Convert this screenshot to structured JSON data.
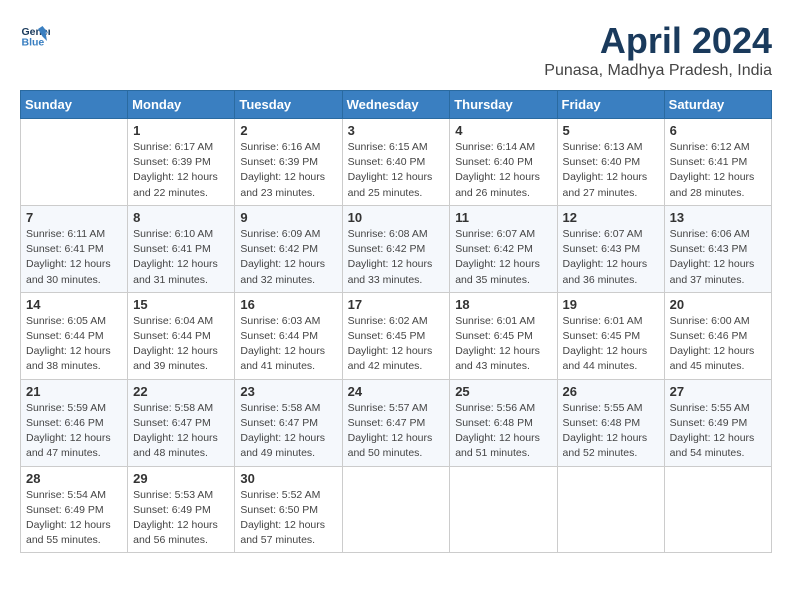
{
  "header": {
    "logo_line1": "General",
    "logo_line2": "Blue",
    "month": "April 2024",
    "location": "Punasa, Madhya Pradesh, India"
  },
  "weekdays": [
    "Sunday",
    "Monday",
    "Tuesday",
    "Wednesday",
    "Thursday",
    "Friday",
    "Saturday"
  ],
  "weeks": [
    [
      {
        "day": "",
        "sunrise": "",
        "sunset": "",
        "daylight": ""
      },
      {
        "day": "1",
        "sunrise": "Sunrise: 6:17 AM",
        "sunset": "Sunset: 6:39 PM",
        "daylight": "Daylight: 12 hours and 22 minutes."
      },
      {
        "day": "2",
        "sunrise": "Sunrise: 6:16 AM",
        "sunset": "Sunset: 6:39 PM",
        "daylight": "Daylight: 12 hours and 23 minutes."
      },
      {
        "day": "3",
        "sunrise": "Sunrise: 6:15 AM",
        "sunset": "Sunset: 6:40 PM",
        "daylight": "Daylight: 12 hours and 25 minutes."
      },
      {
        "day": "4",
        "sunrise": "Sunrise: 6:14 AM",
        "sunset": "Sunset: 6:40 PM",
        "daylight": "Daylight: 12 hours and 26 minutes."
      },
      {
        "day": "5",
        "sunrise": "Sunrise: 6:13 AM",
        "sunset": "Sunset: 6:40 PM",
        "daylight": "Daylight: 12 hours and 27 minutes."
      },
      {
        "day": "6",
        "sunrise": "Sunrise: 6:12 AM",
        "sunset": "Sunset: 6:41 PM",
        "daylight": "Daylight: 12 hours and 28 minutes."
      }
    ],
    [
      {
        "day": "7",
        "sunrise": "Sunrise: 6:11 AM",
        "sunset": "Sunset: 6:41 PM",
        "daylight": "Daylight: 12 hours and 30 minutes."
      },
      {
        "day": "8",
        "sunrise": "Sunrise: 6:10 AM",
        "sunset": "Sunset: 6:41 PM",
        "daylight": "Daylight: 12 hours and 31 minutes."
      },
      {
        "day": "9",
        "sunrise": "Sunrise: 6:09 AM",
        "sunset": "Sunset: 6:42 PM",
        "daylight": "Daylight: 12 hours and 32 minutes."
      },
      {
        "day": "10",
        "sunrise": "Sunrise: 6:08 AM",
        "sunset": "Sunset: 6:42 PM",
        "daylight": "Daylight: 12 hours and 33 minutes."
      },
      {
        "day": "11",
        "sunrise": "Sunrise: 6:07 AM",
        "sunset": "Sunset: 6:42 PM",
        "daylight": "Daylight: 12 hours and 35 minutes."
      },
      {
        "day": "12",
        "sunrise": "Sunrise: 6:07 AM",
        "sunset": "Sunset: 6:43 PM",
        "daylight": "Daylight: 12 hours and 36 minutes."
      },
      {
        "day": "13",
        "sunrise": "Sunrise: 6:06 AM",
        "sunset": "Sunset: 6:43 PM",
        "daylight": "Daylight: 12 hours and 37 minutes."
      }
    ],
    [
      {
        "day": "14",
        "sunrise": "Sunrise: 6:05 AM",
        "sunset": "Sunset: 6:44 PM",
        "daylight": "Daylight: 12 hours and 38 minutes."
      },
      {
        "day": "15",
        "sunrise": "Sunrise: 6:04 AM",
        "sunset": "Sunset: 6:44 PM",
        "daylight": "Daylight: 12 hours and 39 minutes."
      },
      {
        "day": "16",
        "sunrise": "Sunrise: 6:03 AM",
        "sunset": "Sunset: 6:44 PM",
        "daylight": "Daylight: 12 hours and 41 minutes."
      },
      {
        "day": "17",
        "sunrise": "Sunrise: 6:02 AM",
        "sunset": "Sunset: 6:45 PM",
        "daylight": "Daylight: 12 hours and 42 minutes."
      },
      {
        "day": "18",
        "sunrise": "Sunrise: 6:01 AM",
        "sunset": "Sunset: 6:45 PM",
        "daylight": "Daylight: 12 hours and 43 minutes."
      },
      {
        "day": "19",
        "sunrise": "Sunrise: 6:01 AM",
        "sunset": "Sunset: 6:45 PM",
        "daylight": "Daylight: 12 hours and 44 minutes."
      },
      {
        "day": "20",
        "sunrise": "Sunrise: 6:00 AM",
        "sunset": "Sunset: 6:46 PM",
        "daylight": "Daylight: 12 hours and 45 minutes."
      }
    ],
    [
      {
        "day": "21",
        "sunrise": "Sunrise: 5:59 AM",
        "sunset": "Sunset: 6:46 PM",
        "daylight": "Daylight: 12 hours and 47 minutes."
      },
      {
        "day": "22",
        "sunrise": "Sunrise: 5:58 AM",
        "sunset": "Sunset: 6:47 PM",
        "daylight": "Daylight: 12 hours and 48 minutes."
      },
      {
        "day": "23",
        "sunrise": "Sunrise: 5:58 AM",
        "sunset": "Sunset: 6:47 PM",
        "daylight": "Daylight: 12 hours and 49 minutes."
      },
      {
        "day": "24",
        "sunrise": "Sunrise: 5:57 AM",
        "sunset": "Sunset: 6:47 PM",
        "daylight": "Daylight: 12 hours and 50 minutes."
      },
      {
        "day": "25",
        "sunrise": "Sunrise: 5:56 AM",
        "sunset": "Sunset: 6:48 PM",
        "daylight": "Daylight: 12 hours and 51 minutes."
      },
      {
        "day": "26",
        "sunrise": "Sunrise: 5:55 AM",
        "sunset": "Sunset: 6:48 PM",
        "daylight": "Daylight: 12 hours and 52 minutes."
      },
      {
        "day": "27",
        "sunrise": "Sunrise: 5:55 AM",
        "sunset": "Sunset: 6:49 PM",
        "daylight": "Daylight: 12 hours and 54 minutes."
      }
    ],
    [
      {
        "day": "28",
        "sunrise": "Sunrise: 5:54 AM",
        "sunset": "Sunset: 6:49 PM",
        "daylight": "Daylight: 12 hours and 55 minutes."
      },
      {
        "day": "29",
        "sunrise": "Sunrise: 5:53 AM",
        "sunset": "Sunset: 6:49 PM",
        "daylight": "Daylight: 12 hours and 56 minutes."
      },
      {
        "day": "30",
        "sunrise": "Sunrise: 5:52 AM",
        "sunset": "Sunset: 6:50 PM",
        "daylight": "Daylight: 12 hours and 57 minutes."
      },
      {
        "day": "",
        "sunrise": "",
        "sunset": "",
        "daylight": ""
      },
      {
        "day": "",
        "sunrise": "",
        "sunset": "",
        "daylight": ""
      },
      {
        "day": "",
        "sunrise": "",
        "sunset": "",
        "daylight": ""
      },
      {
        "day": "",
        "sunrise": "",
        "sunset": "",
        "daylight": ""
      }
    ]
  ]
}
